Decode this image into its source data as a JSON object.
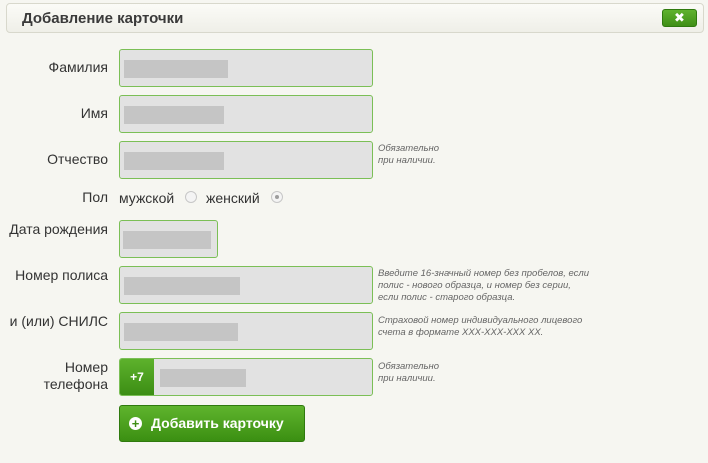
{
  "dialog": {
    "title": "Добавление карточки",
    "close_label": "✖"
  },
  "form": {
    "surname_label": "Фамилия",
    "name_label": "Имя",
    "patronymic_label": "Отчество",
    "patronymic_hint": "Обязательно при наличии.",
    "gender_label": "Пол",
    "gender_male": "мужской",
    "gender_female": "женский",
    "gender_selected": "женский",
    "birthdate_label": "Дата рождения",
    "policy_label": "Номер полиса",
    "policy_hint": "Введите 16-значный номер без пробелов, если полис - нового образца, и номер без серии, если полис - старого образца.",
    "snils_label": "и (или) СНИЛС",
    "snils_hint": "Страховой номер индивидуального лицевого счета в формате XXX-XXX-XXX XX.",
    "phone_label": "Номер телефона",
    "phone_prefix": "+7",
    "phone_hint": "Обязательно при наличии.",
    "submit_label": "Добавить карточку"
  },
  "colors": {
    "accent": "#4a9d1f",
    "field_border": "#7bbf56",
    "field_bg": "#e2e2e2"
  },
  "icons": {
    "close": "close-icon",
    "add": "plus-circle-icon"
  }
}
